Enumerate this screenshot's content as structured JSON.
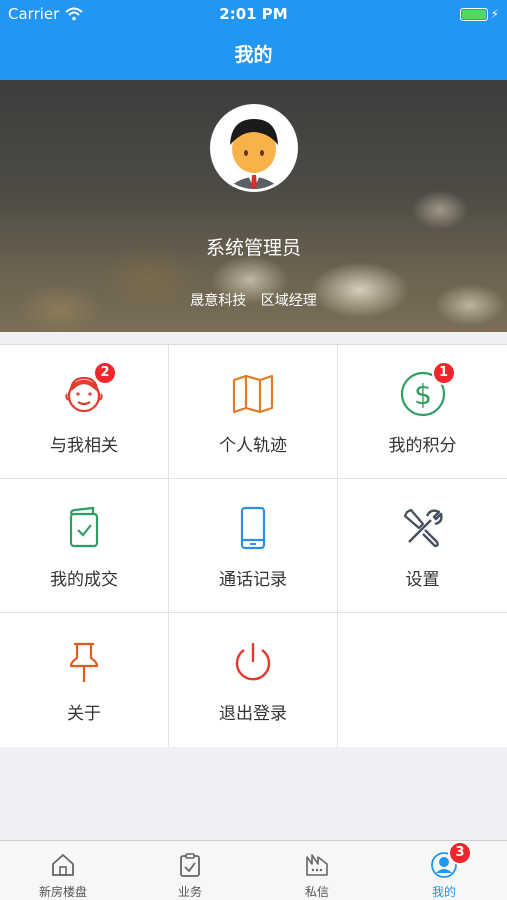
{
  "status_bar": {
    "carrier": "Carrier",
    "time": "2:01 PM"
  },
  "nav": {
    "title": "我的"
  },
  "profile": {
    "name": "系统管理员",
    "company": "晟意科技",
    "role": "区域经理"
  },
  "menu": [
    {
      "label": "与我相关",
      "icon": "face-icon",
      "badge": "2",
      "color": "#e23a2e"
    },
    {
      "label": "个人轨迹",
      "icon": "map-icon",
      "badge": "",
      "color": "#e07b27"
    },
    {
      "label": "我的积分",
      "icon": "dollar-icon",
      "badge": "1",
      "color": "#2e9e62"
    },
    {
      "label": "我的成交",
      "icon": "deal-icon",
      "badge": "",
      "color": "#2e9e62"
    },
    {
      "label": "通话记录",
      "icon": "phone-icon",
      "badge": "",
      "color": "#2d8ee6"
    },
    {
      "label": "设置",
      "icon": "tools-icon",
      "badge": "",
      "color": "#44505e"
    },
    {
      "label": "关于",
      "icon": "pin-icon",
      "badge": "",
      "color": "#e05b1e"
    },
    {
      "label": "退出登录",
      "icon": "power-icon",
      "badge": "",
      "color": "#e23a2e"
    }
  ],
  "tabs": [
    {
      "label": "新房楼盘",
      "icon": "home-icon",
      "active": false
    },
    {
      "label": "业务",
      "icon": "clipboard-icon",
      "active": false
    },
    {
      "label": "私信",
      "icon": "message-icon",
      "active": false
    },
    {
      "label": "我的",
      "icon": "user-icon",
      "active": true,
      "badge": "3"
    }
  ],
  "colors": {
    "accent": "#2196f3",
    "badge": "#f0262c"
  }
}
